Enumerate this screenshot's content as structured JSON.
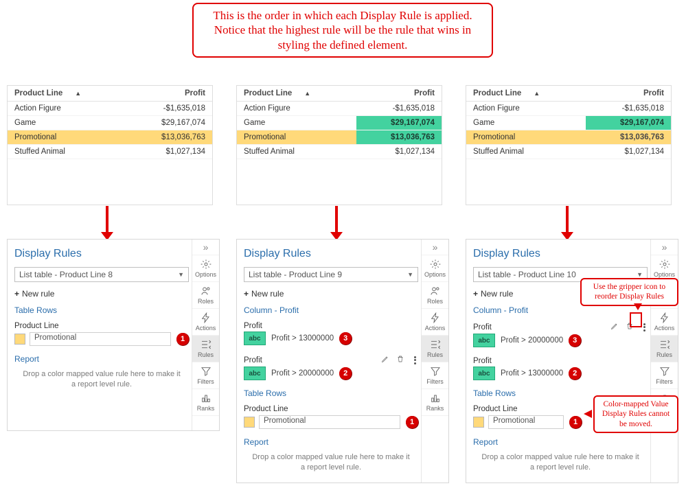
{
  "annotations": {
    "top": "This is the order in which each Display Rule is applied.  Notice that the highest rule will be the rule that wins in styling the defined element.",
    "gripper_note": "Use the gripper icon to reorder Display Rules",
    "colormap_note": "Color-mapped Value Display Rules cannot be moved."
  },
  "tables": {
    "headers": {
      "col1": "Product Line",
      "col2": "Profit"
    },
    "rows": [
      {
        "pl": "Action Figure",
        "profit": "-$1,635,018"
      },
      {
        "pl": "Game",
        "profit": "$29,167,074"
      },
      {
        "pl": "Promotional",
        "profit": "$13,036,763"
      },
      {
        "pl": "Stuffed Animal",
        "profit": "$1,027,134"
      }
    ]
  },
  "panels": {
    "title": "Display Rules",
    "new_rule": "New rule",
    "sec_table_rows": "Table Rows",
    "sec_column_profit": "Column - Profit",
    "report": "Report",
    "drop_text": "Drop a color mapped value rule here to make it a report level rule.",
    "product_line_label": "Product Line",
    "product_line_value": "Promotional",
    "profit_label": "Profit",
    "profit_gt_13": "Profit > 13000000",
    "profit_gt_20": "Profit > 20000000",
    "abc": "abc",
    "selects": {
      "p1": "List table - Product Line 8",
      "p2": "List table - Product Line 9",
      "p3": "List table - Product Line 10"
    }
  },
  "sidebar": {
    "options": "Options",
    "roles": "Roles",
    "actions": "Actions",
    "rules": "Rules",
    "filters": "Filters",
    "ranks": "Ranks"
  },
  "badges": {
    "b1": "1",
    "b2": "2",
    "b3": "3"
  }
}
